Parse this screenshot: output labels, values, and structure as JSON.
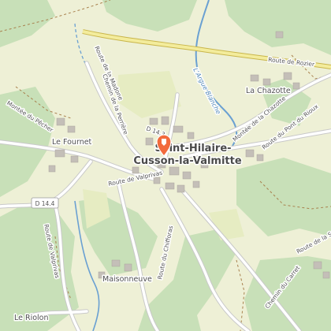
{
  "map": {
    "town_name_line1": "Saint-Hilaire-",
    "town_name_line2": "Cusson-la-Valmitte",
    "places": {
      "la_chazotte": "La Chazotte",
      "le_fournet": "Le Fournet",
      "maisonneuve": "Maisonneuve",
      "le_riolon": "Le Riolon"
    },
    "roads": {
      "route_de_rozier": "Route de Rozier",
      "route_de_la_madone": "Route de la Madone",
      "chemin_de_la_perriere": "Chemin de la Perrière",
      "d143": "D 14.3",
      "montee_de_la_chazotte": "Montée de la Chazotte",
      "route_du_pont_du_rioux": "Route du Pont du Rioux",
      "montee_du_pecher": "Montée du Pêcher",
      "route_de_valprivas": "Route de Valprivas",
      "d144": "D 14.4",
      "route_de_valprivas_2": "Route de Valprivas",
      "route_du_chifforas": "Route du Chifforas",
      "chemin_du_carret": "Chemin du Carret",
      "route_de_la_s": "Route de la S"
    },
    "river": "L'Argue Blanche",
    "marker_icon": "map-pin-icon",
    "colors": {
      "background": "#eef0d6",
      "forest": "#c8e0b8",
      "road_main": "#f3ec9c",
      "road_minor": "#ffffff",
      "river": "#6aa0d2",
      "marker": "#f26a3c"
    }
  }
}
